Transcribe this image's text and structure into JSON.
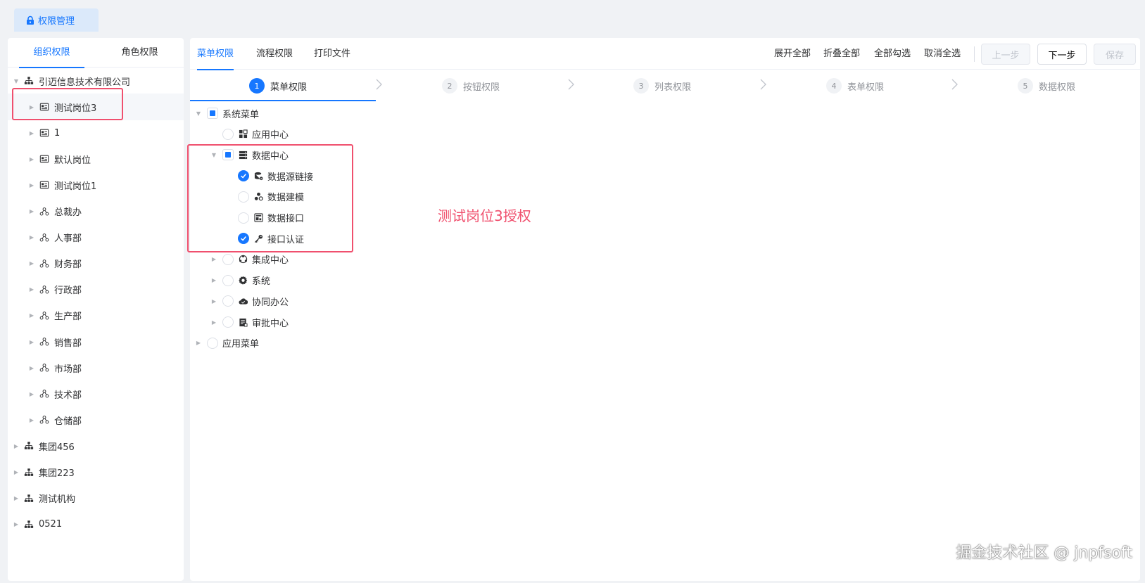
{
  "top_tab": {
    "label": "权限管理"
  },
  "left": {
    "tabs": [
      {
        "label": "组织权限",
        "active": true
      },
      {
        "label": "角色权限",
        "active": false
      }
    ],
    "tree": [
      {
        "label": "引迈信息技术有限公司",
        "level": 0,
        "icon": "org-icon",
        "expanded": true
      },
      {
        "label": "测试岗位3",
        "level": 1,
        "icon": "position-icon",
        "selected": true
      },
      {
        "label": "1",
        "level": 1,
        "icon": "position-icon"
      },
      {
        "label": "默认岗位",
        "level": 1,
        "icon": "position-icon"
      },
      {
        "label": "测试岗位1",
        "level": 1,
        "icon": "position-icon"
      },
      {
        "label": "总裁办",
        "level": 1,
        "icon": "dept-icon"
      },
      {
        "label": "人事部",
        "level": 1,
        "icon": "dept-icon"
      },
      {
        "label": "财务部",
        "level": 1,
        "icon": "dept-icon"
      },
      {
        "label": "行政部",
        "level": 1,
        "icon": "dept-icon"
      },
      {
        "label": "生产部",
        "level": 1,
        "icon": "dept-icon"
      },
      {
        "label": "销售部",
        "level": 1,
        "icon": "dept-icon"
      },
      {
        "label": "市场部",
        "level": 1,
        "icon": "dept-icon"
      },
      {
        "label": "技术部",
        "level": 1,
        "icon": "dept-icon"
      },
      {
        "label": "仓储部",
        "level": 1,
        "icon": "dept-icon"
      },
      {
        "label": "集团456",
        "level": 0,
        "icon": "org-icon"
      },
      {
        "label": "集团223",
        "level": 0,
        "icon": "org-icon"
      },
      {
        "label": "测试机构",
        "level": 0,
        "icon": "org-icon"
      },
      {
        "label": "0521",
        "level": 0,
        "icon": "org-icon"
      }
    ]
  },
  "main": {
    "tabs": [
      {
        "label": "菜单权限",
        "active": true
      },
      {
        "label": "流程权限",
        "active": false
      },
      {
        "label": "打印文件",
        "active": false
      }
    ],
    "actions": {
      "expand_all": "展开全部",
      "collapse_all": "折叠全部",
      "check_all": "全部勾选",
      "uncheck_all": "取消全选"
    },
    "buttons": {
      "prev": "上一步",
      "next": "下一步",
      "save": "保存"
    },
    "steps": [
      {
        "num": "1",
        "label": "菜单权限",
        "active": true
      },
      {
        "num": "2",
        "label": "按钮权限"
      },
      {
        "num": "3",
        "label": "列表权限"
      },
      {
        "num": "4",
        "label": "表单权限"
      },
      {
        "num": "5",
        "label": "数据权限"
      }
    ],
    "menu_tree": [
      {
        "label": "系统菜单",
        "level": 0,
        "state": "indeterminate",
        "arrow": "down"
      },
      {
        "label": "应用中心",
        "level": 1,
        "state": "unchecked",
        "icon": "app-center-icon"
      },
      {
        "label": "数据中心",
        "level": 1,
        "state": "indeterminate",
        "icon": "data-center-icon",
        "arrow": "down"
      },
      {
        "label": "数据源链接",
        "level": 2,
        "state": "checked",
        "icon": "database-icon"
      },
      {
        "label": "数据建模",
        "level": 2,
        "state": "unchecked",
        "icon": "modeling-icon"
      },
      {
        "label": "数据接口",
        "level": 2,
        "state": "unchecked",
        "icon": "interface-icon"
      },
      {
        "label": "接口认证",
        "level": 2,
        "state": "checked",
        "icon": "key-icon"
      },
      {
        "label": "集成中心",
        "level": 1,
        "state": "unchecked",
        "icon": "integration-icon",
        "arrow": "right"
      },
      {
        "label": "系统",
        "level": 1,
        "state": "unchecked",
        "icon": "gear-icon",
        "arrow": "right"
      },
      {
        "label": "协同办公",
        "level": 1,
        "state": "unchecked",
        "icon": "cloud-icon",
        "arrow": "right"
      },
      {
        "label": "审批中心",
        "level": 1,
        "state": "unchecked",
        "icon": "approval-icon",
        "arrow": "right"
      },
      {
        "label": "应用菜单",
        "level": 0,
        "state": "unchecked",
        "arrow": "right"
      }
    ],
    "annotation": "测试岗位3授权"
  },
  "watermark": "掘金技术社区 @ jnpfsoft",
  "colors": {
    "accent": "#1677ff",
    "highlight": "#f0506e"
  }
}
